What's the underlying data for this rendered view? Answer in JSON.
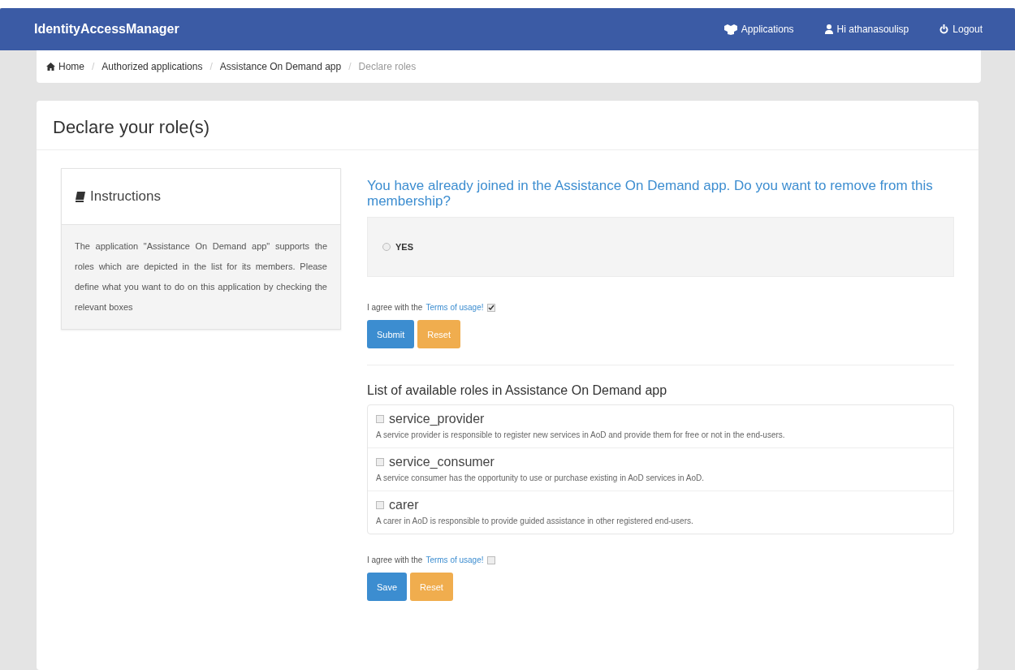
{
  "navbar": {
    "brand": "IdentityAccessManager",
    "links": [
      {
        "kind": "apps",
        "label": "Applications"
      },
      {
        "kind": "user",
        "label": "Hi athanasoulisp"
      },
      {
        "kind": "logout",
        "label": "Logout"
      }
    ]
  },
  "breadcrumb": [
    {
      "label": "Home",
      "kind": "home",
      "active": false
    },
    {
      "separator": "/",
      "label": "Authorized applications",
      "active": false
    },
    {
      "separator": "/",
      "label": "Assistance On Demand app",
      "active": false
    },
    {
      "separator": "/",
      "label": "Declare roles",
      "active": true
    }
  ],
  "page_title": "Declare your role(s)",
  "instructions": {
    "title": "Instructions",
    "text": "The application \"Assistance On Demand app\" supports the roles which are depicted in the list for its members. Please define what you want to do on this application by checking the relevant boxes"
  },
  "membership": {
    "question": "You have already joined in the Assistance On Demand app. Do you want to remove from this membership?",
    "option": {
      "label": "YES",
      "selected": false
    },
    "terms": {
      "text": "I agree with the",
      "link": "Terms of usage!",
      "checked": true
    },
    "buttons": [
      {
        "kind": "primary",
        "label": "Submit"
      },
      {
        "kind": "warning",
        "label": "Reset"
      }
    ]
  },
  "roles": {
    "title": "List of available roles in Assistance On Demand app",
    "items": [
      {
        "name": "service_provider",
        "checked": false,
        "description": "A service provider is responsible to register new services in AoD and provide them for free or not in the end-users."
      },
      {
        "name": "service_consumer",
        "checked": false,
        "description": "A service consumer has the opportunity to use or purchase existing in AoD services in AoD."
      },
      {
        "name": "carer",
        "checked": false,
        "description": "A carer in AoD is responsible to provide guided assistance in other registered end-users."
      }
    ],
    "terms": {
      "text": "I agree with the",
      "link": "Terms of usage!",
      "checked": false
    },
    "buttons": [
      {
        "kind": "primary",
        "label": "Save"
      },
      {
        "kind": "warning",
        "label": "Reset"
      }
    ]
  }
}
